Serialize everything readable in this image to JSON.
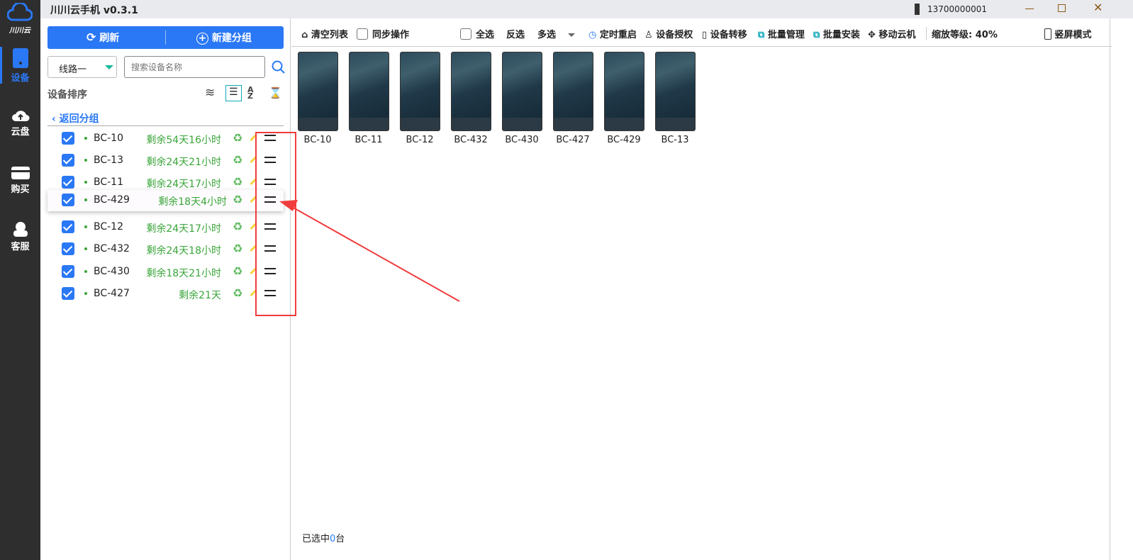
{
  "app": {
    "title": "川川云手机 v0.3.1",
    "logo_text": "川川云",
    "account": "13700000001"
  },
  "nav": [
    {
      "label": "设备",
      "icon": "phone-icon",
      "active": true
    },
    {
      "label": "云盘",
      "icon": "cloud-upload-icon"
    },
    {
      "label": "购买",
      "icon": "card-icon"
    },
    {
      "label": "客服",
      "icon": "headset-icon"
    }
  ],
  "left": {
    "refresh": "刷新",
    "new_group": "新建分组",
    "line_select": "线路一",
    "search_placeholder": "搜索设备名称",
    "sort_label": "设备排序",
    "back": "返回分组",
    "devices": [
      {
        "name": "BC-10",
        "remaining": "剩余54天16小时",
        "checked": true
      },
      {
        "name": "BC-13",
        "remaining": "剩余24天21小时",
        "checked": true
      },
      {
        "name": "BC-11",
        "remaining": "剩余24天17小时",
        "checked": true
      },
      {
        "name": "BC-429",
        "remaining": "剩余18天4小时",
        "checked": true,
        "dragging": true
      },
      {
        "name": "BC-12",
        "remaining": "剩余24天17小时",
        "checked": true
      },
      {
        "name": "BC-432",
        "remaining": "剩余24天18小时",
        "checked": true
      },
      {
        "name": "BC-430",
        "remaining": "剩余18天21小时",
        "checked": true
      },
      {
        "name": "BC-427",
        "remaining": "剩余21天",
        "checked": true
      }
    ]
  },
  "toolbar": {
    "clear": "清空列表",
    "sync": "同步操作",
    "select_all": "全选",
    "invert": "反选",
    "multi": "多选",
    "timed_restart": "定时重启",
    "auth": "设备授权",
    "transfer": "设备转移",
    "batch_manage": "批量管理",
    "batch_install": "批量安装",
    "move": "移动云机",
    "zoom_label": "缩放等级:",
    "zoom_value": "40%",
    "portrait": "竖屏模式"
  },
  "screens": [
    "BC-10",
    "BC-11",
    "BC-12",
    "BC-432",
    "BC-430",
    "BC-427",
    "BC-429",
    "BC-13"
  ],
  "status": {
    "prefix": "已选中",
    "count": "0",
    "suffix": "台"
  },
  "colors": {
    "accent": "#2a78f5",
    "green": "#3aa53a",
    "annotation": "#f03c3c"
  }
}
